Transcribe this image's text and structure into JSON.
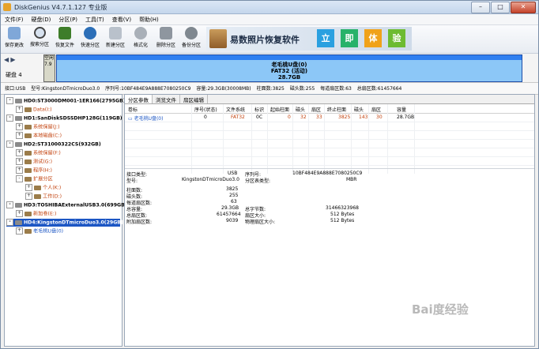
{
  "window": {
    "title": "DiskGenius V4.7.1.127 专业版"
  },
  "menu": [
    "文件(F)",
    "硬盘(D)",
    "分区(P)",
    "工具(T)",
    "查看(V)",
    "帮助(H)"
  ],
  "toolbar": {
    "buttons": [
      "保存更改",
      "搜索分区",
      "恢复文件",
      "快速分区",
      "新建分区",
      "格式化",
      "删除分区",
      "备份分区"
    ],
    "banner_text": "易数照片恢复软件",
    "banner_badges": [
      "立",
      "即",
      "体",
      "验"
    ]
  },
  "diskbar": {
    "left_label": "硬盘 4",
    "small_part": {
      "line1": "空闲",
      "line2": "7.9"
    },
    "main_part": {
      "name": "老毛桃U盘(0)",
      "fs": "FAT32 (活动)",
      "size": "28.7GB"
    }
  },
  "infobar": {
    "items": [
      "接口:USB",
      "型号:KingstonDTmicroDuo3.0",
      "序列号:10BF484E9A888E7080250C9",
      "容量:29.3GB(30008MB)",
      "柱面数:3825",
      "磁头数:255",
      "每道扇区数:63",
      "总扇区数:61457664"
    ]
  },
  "tree": [
    {
      "label": "HD0:ST3000DM001-1ER166(2795GB)",
      "type": "disk",
      "toggle": "-"
    },
    {
      "label": "Data(I:)",
      "type": "part",
      "toggle": "+"
    },
    {
      "label": "HD1:SanDiskSDSSDHP128G(119GB)",
      "type": "disk",
      "toggle": "-"
    },
    {
      "label": "系统保留(J:)",
      "type": "part",
      "toggle": "+"
    },
    {
      "label": "本地磁盘(C:)",
      "type": "part",
      "toggle": "+"
    },
    {
      "label": "HD2:ST31000322CS(932GB)",
      "type": "disk",
      "toggle": "-"
    },
    {
      "label": "系统保留(F:)",
      "type": "part",
      "toggle": "+"
    },
    {
      "label": "测试(G:)",
      "type": "part",
      "toggle": "+"
    },
    {
      "label": "程序(H:)",
      "type": "part",
      "toggle": "+"
    },
    {
      "label": "扩展分区",
      "type": "part",
      "toggle": "-"
    },
    {
      "label": "个人(K:)",
      "type": "part",
      "toggle": "+"
    },
    {
      "label": "工作(D:)",
      "type": "part",
      "toggle": "+"
    },
    {
      "label": "HD3:TOSHIBAExternalUSB3.0(699GB)",
      "type": "disk",
      "toggle": "-"
    },
    {
      "label": "新加卷(E:)",
      "type": "part",
      "toggle": "+"
    },
    {
      "label": "HD4:KingstonDTmicroDuo3.0(29GB)",
      "type": "disk",
      "toggle": "-",
      "selected": true
    },
    {
      "label": "老毛桃U盘(0)",
      "type": "part",
      "toggle": "+"
    }
  ],
  "tabs": [
    "分区参数",
    "浏览文件",
    "扇区编辑"
  ],
  "table": {
    "headers": [
      "卷标",
      "序号(状态)",
      "文件系统",
      "标识",
      "起始柱面",
      "磁头",
      "扇区",
      "终止柱面",
      "磁头",
      "扇区",
      "容量"
    ],
    "row": [
      "老毛桃U盘(0)",
      "0",
      "FAT32",
      "0C",
      "0",
      "32",
      "33",
      "3825",
      "143",
      "30",
      "28.7GB"
    ]
  },
  "props": {
    "left": [
      {
        "k": "接口类型:",
        "v": "USB"
      },
      {
        "k": "型号:",
        "v": "KingstonDTmicroDuo3.0"
      },
      {
        "k": "柱面数:",
        "v": "3825"
      },
      {
        "k": "磁头数:",
        "v": "255"
      },
      {
        "k": "每道扇区数:",
        "v": "63"
      },
      {
        "k": "总容量:",
        "v": "29.3GB"
      },
      {
        "k": "总扇区数:",
        "v": "61457664"
      },
      {
        "k": "附加扇区数:",
        "v": "9039"
      }
    ],
    "right": [
      {
        "k": "序列号:",
        "v": "10BF484E9A888E7080250C9"
      },
      {
        "k": "分区表类型:",
        "v": "MBR"
      },
      {
        "k": "总字节数:",
        "v": "31466323968"
      },
      {
        "k": "扇区大小:",
        "v": "512 Bytes"
      },
      {
        "k": "物理扇区大小:",
        "v": "512 Bytes"
      }
    ]
  },
  "watermark": "Bai度经验"
}
